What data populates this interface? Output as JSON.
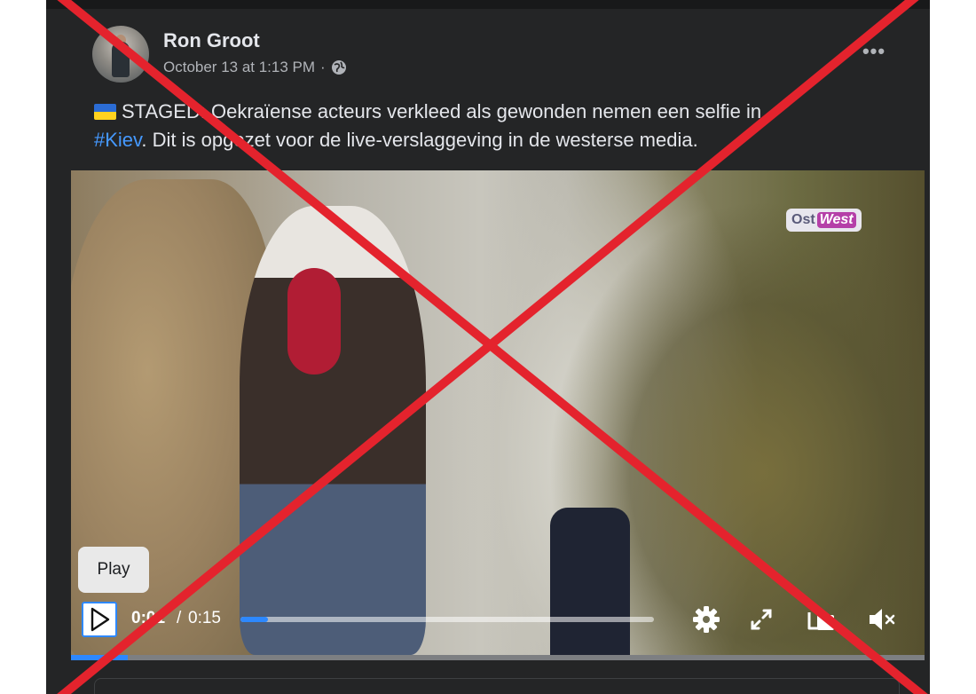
{
  "post": {
    "author_name": "Ron Groot",
    "timestamp": "October 13 at 1:13 PM",
    "meta_separator": "·",
    "privacy_icon": "globe-icon",
    "more_icon": "more-horizontal-icon",
    "more_label": "•••",
    "text_before_hashtag": "STAGED: Oekraïense acteurs verkleed als gewonden nemen een selfie in",
    "hashtag": "#Kiev",
    "text_after_hashtag": ". Dit is opgezet voor de live-verslaggeving in de westerse media.",
    "flag_emoji": "ukraine-flag-icon"
  },
  "video": {
    "watermark_part1": "Ost",
    "watermark_part2": "West",
    "play_tooltip": "Play",
    "current_time": "0:01",
    "time_separator": "/",
    "duration": "0:15",
    "played_fraction": 0.067,
    "icons": [
      "play-icon",
      "settings-gear-icon",
      "fullscreen-expand-icon",
      "picture-in-picture-icon",
      "volume-muted-icon"
    ]
  },
  "overlay": {
    "type": "red-x-cross",
    "color": "#e4232d"
  },
  "colors": {
    "card_background": "#242526",
    "text_primary": "#e4e6eb",
    "text_secondary": "#b0b3b8",
    "link": "#4599ff",
    "accent": "#2d88ff"
  }
}
